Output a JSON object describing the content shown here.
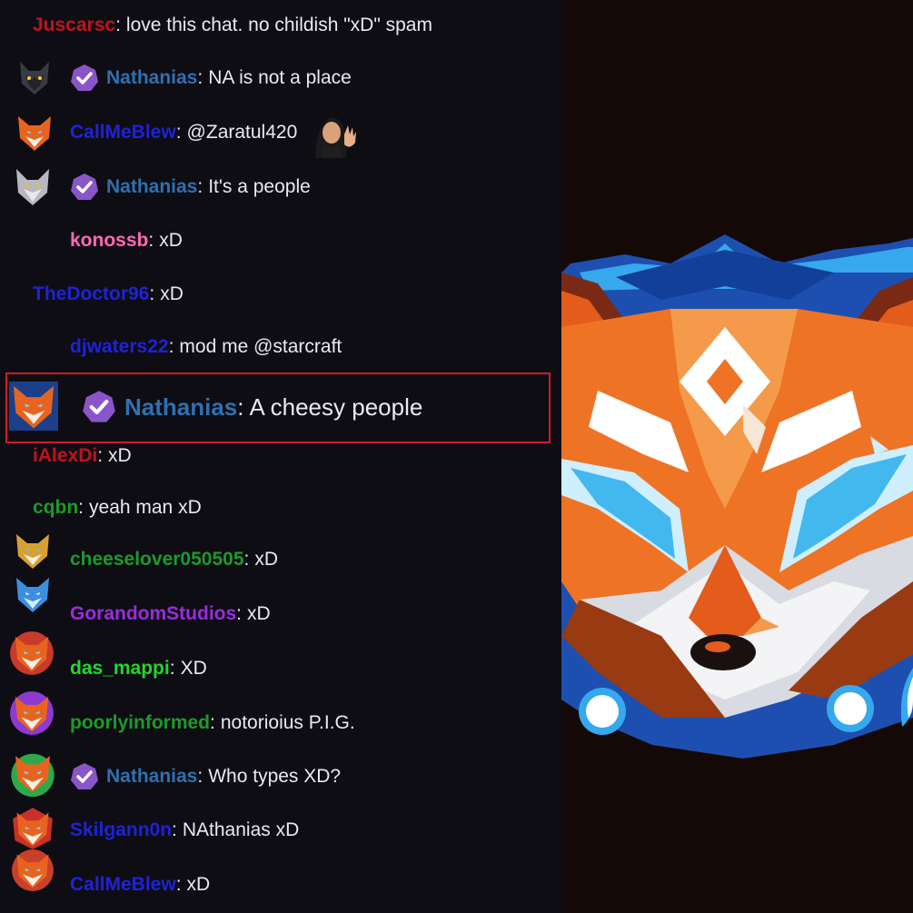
{
  "colors": {
    "red": "#c0141c",
    "blue_dark": "#1f22d8",
    "steel_blue": "#2f70b0",
    "pink": "#ff69b4",
    "green": "#1c9a2a",
    "bright_green": "#20d82a",
    "purple": "#9a2ce0",
    "verified_badge": "#8a55c8"
  },
  "icons": {
    "verified": "verified-check-icon",
    "wave_emote": "waving-woman-emote-icon"
  },
  "messages": [
    {
      "user": "Juscarsc",
      "text": "love this chat. no childish \"xD\" spam",
      "color": "#c0141c",
      "avatar": "none",
      "verified": false
    },
    {
      "user": "Nathanias",
      "text": "NA is not a place",
      "color": "#2f70b0",
      "avatar": "dark-wolf-avatar-icon",
      "verified": true
    },
    {
      "user": "CallMeBlew",
      "text": "@Zaratul420",
      "color": "#1f22d8",
      "avatar": "orange-fox-avatar-icon",
      "verified": false,
      "emote": "waving-woman-emote-icon"
    },
    {
      "user": "Nathanias",
      "text": "It's a people",
      "color": "#2f70b0",
      "avatar": "grey-wolf-avatar-icon",
      "verified": true
    },
    {
      "user": "konossb",
      "text": "xD",
      "color": "#ff69b4",
      "avatar": "none",
      "verified": false
    },
    {
      "user": "TheDoctor96",
      "text": "xD",
      "color": "#1f22d8",
      "avatar": "none",
      "verified": false
    },
    {
      "user": "djwaters22",
      "text": "mod me @starcraft",
      "color": "#1f22d8",
      "avatar": "none",
      "verified": false
    },
    {
      "user": "Nathanias",
      "text": "A cheesy people",
      "color": "#2f70b0",
      "avatar": "blue-fox-avatar-icon",
      "verified": true,
      "highlighted": true
    },
    {
      "user": "iAlexDi",
      "text": "xD",
      "color": "#c0141c",
      "avatar": "none",
      "verified": false
    },
    {
      "user": "cqbn",
      "text": "yeah man xD",
      "color": "#1c9a2a",
      "avatar": "none",
      "verified": false
    },
    {
      "user": "cheeselover050505",
      "text": "xD",
      "color": "#1c9a2a",
      "avatar": "gold-fox-avatar-icon",
      "verified": false
    },
    {
      "user": "GorandomStudios",
      "text": "xD",
      "color": "#9a2ce0",
      "avatar": "blue-wolf-avatar-icon",
      "verified": false
    },
    {
      "user": "das_mappi",
      "text": "XD",
      "color": "#20d82a",
      "avatar": "orange-fox-avatar-icon",
      "verified": false
    },
    {
      "user": "poorlyinformed",
      "text": "notorioius P.I.G.",
      "color": "#1c9a2a",
      "avatar": "purple-fox-avatar-icon",
      "verified": false
    },
    {
      "user": "Nathanias",
      "text": "Who types XD?",
      "color": "#2f70b0",
      "avatar": "green-fox-avatar-icon",
      "verified": true
    },
    {
      "user": "Skilgann0n",
      "text": "NAthanias xD",
      "color": "#1f22d8",
      "avatar": "red-fox-avatar-icon",
      "verified": false
    },
    {
      "user": "CallMeBlew",
      "text": "xD",
      "color": "#1f22d8",
      "avatar": "orange-fox-avatar-icon",
      "verified": false
    }
  ],
  "logo": {
    "name": "fox-mascot-logo-icon"
  }
}
